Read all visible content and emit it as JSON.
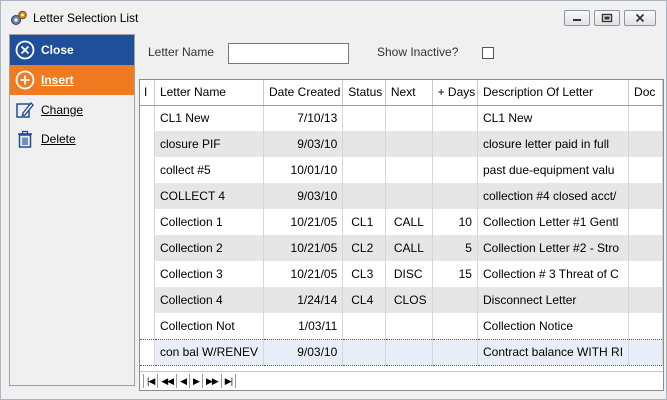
{
  "window": {
    "title": "Letter Selection List",
    "icon": "gears-icon"
  },
  "commands": [
    {
      "label": "Close",
      "icon": "close-circle-icon"
    },
    {
      "label": "Insert",
      "icon": "plus-circle-icon"
    },
    {
      "label": "Change",
      "icon": "pencil-icon"
    },
    {
      "label": "Delete",
      "icon": "trash-icon"
    }
  ],
  "filter": {
    "letter_name_label": "Letter Name",
    "letter_name_value": "",
    "show_inactive_label": "Show Inactive?",
    "show_inactive_checked": false
  },
  "grid": {
    "columns": [
      "I",
      "Letter Name",
      "Date Created",
      "Status",
      "Next",
      "+ Days",
      "Description Of Letter",
      "Doc"
    ],
    "rows": [
      {
        "name": "CL1 New",
        "date": "7/10/13",
        "status": "",
        "next": "",
        "days": "",
        "desc": "CL1 New"
      },
      {
        "name": "closure PIF",
        "date": "9/03/10",
        "status": "",
        "next": "",
        "days": "",
        "desc": "closure letter paid in full"
      },
      {
        "name": "collect #5",
        "date": "10/01/10",
        "status": "",
        "next": "",
        "days": "",
        "desc": "past due-equipment valu"
      },
      {
        "name": "COLLECT 4",
        "date": "9/03/10",
        "status": "",
        "next": "",
        "days": "",
        "desc": "collection #4 closed acct/"
      },
      {
        "name": "Collection 1",
        "date": "10/21/05",
        "status": "CL1",
        "next": "CALL",
        "days": "10",
        "desc": "Collection Letter #1 Gentl"
      },
      {
        "name": "Collection 2",
        "date": "10/21/05",
        "status": "CL2",
        "next": "CALL",
        "days": "5",
        "desc": "Collection Letter #2 - Stro"
      },
      {
        "name": "Collection 3",
        "date": "10/21/05",
        "status": "CL3",
        "next": "DISC",
        "days": "15",
        "desc": "Collection # 3 Threat of C"
      },
      {
        "name": "Collection 4",
        "date": "1/24/14",
        "status": "CL4",
        "next": "CLOS",
        "days": "",
        "desc": "Disconnect Letter"
      },
      {
        "name": "Collection Not",
        "date": "1/03/11",
        "status": "",
        "next": "",
        "days": "",
        "desc": "Collection Notice"
      },
      {
        "name": "con bal W/RENEV",
        "date": "9/03/10",
        "status": "",
        "next": "",
        "days": "",
        "desc": "Contract balance WITH RI"
      }
    ],
    "selected_row": 9,
    "nav_buttons": [
      "|◀",
      "◀◀",
      "◀",
      "▶",
      "▶▶",
      "▶|"
    ]
  }
}
